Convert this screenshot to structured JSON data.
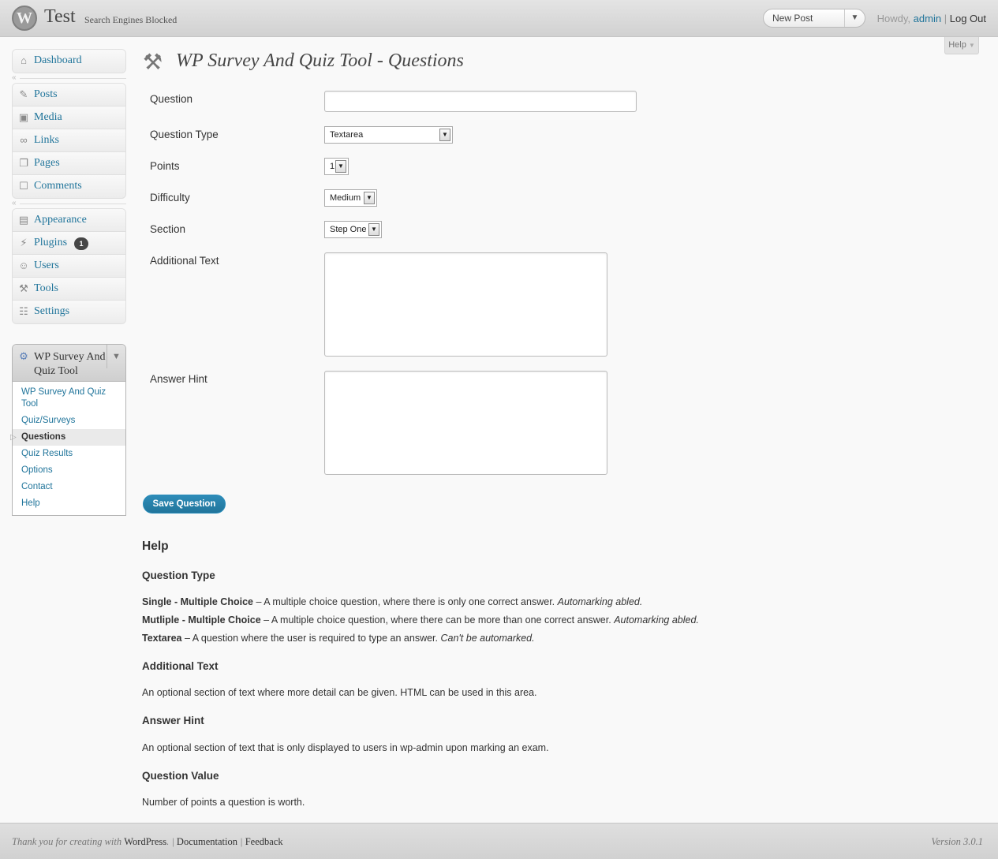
{
  "header": {
    "site_title": "Test",
    "site_status": "Search Engines Blocked",
    "favorite_action": "New Post",
    "howdy": "Howdy,",
    "user": "admin",
    "separator": "|",
    "logout": "Log Out"
  },
  "help_tab": "Help",
  "menu": {
    "group1": [
      {
        "label": "Dashboard",
        "icon": "dashboard-icon"
      }
    ],
    "group2": [
      {
        "label": "Posts",
        "icon": "pin-icon"
      },
      {
        "label": "Media",
        "icon": "media-icon"
      },
      {
        "label": "Links",
        "icon": "link-icon"
      },
      {
        "label": "Pages",
        "icon": "pages-icon"
      },
      {
        "label": "Comments",
        "icon": "comments-icon"
      }
    ],
    "group3": [
      {
        "label": "Appearance",
        "icon": "appearance-icon"
      },
      {
        "label": "Plugins",
        "icon": "plugin-icon",
        "badge": "1"
      },
      {
        "label": "Users",
        "icon": "users-icon"
      },
      {
        "label": "Tools",
        "icon": "tools-icon"
      },
      {
        "label": "Settings",
        "icon": "settings-icon"
      }
    ],
    "plugin": {
      "label": "WP Survey And Quiz Tool",
      "items": [
        "WP Survey And Quiz Tool",
        "Quiz/Surveys",
        "Questions",
        "Quiz Results",
        "Options",
        "Contact",
        "Help"
      ],
      "current": "Questions"
    }
  },
  "page": {
    "title": "WP Survey And Quiz Tool - Questions",
    "fields": {
      "question_label": "Question",
      "question_value": "",
      "type_label": "Question Type",
      "type_value": "Textarea",
      "points_label": "Points",
      "points_value": "1",
      "difficulty_label": "Difficulty",
      "difficulty_value": "Medium",
      "section_label": "Section",
      "section_value": "Step One",
      "additional_label": "Additional Text",
      "additional_value": "",
      "hint_label": "Answer Hint",
      "hint_value": ""
    },
    "save_label": "Save Question"
  },
  "help": {
    "title": "Help",
    "type_heading": "Question Type",
    "type_lines": [
      {
        "term": "Single - Multiple Choice",
        "desc": " – A multiple choice question, where there is only one correct answer. ",
        "note": "Automarking abled."
      },
      {
        "term": "Mutliple - Multiple Choice",
        "desc": " – A multiple choice question, where there can be more than one correct answer. ",
        "note": "Automarking abled."
      },
      {
        "term": "Textarea",
        "desc": " – A question where the user is required to type an answer. ",
        "note": "Can't be automarked."
      }
    ],
    "additional_heading": "Additional Text",
    "additional_text": "An optional section of text where more detail can be given. HTML can be used in this area.",
    "hint_heading": "Answer Hint",
    "hint_text": "An optional section of text that is only displayed to users in wp-admin upon marking an exam.",
    "value_heading": "Question Value",
    "value_text": "Number of points a question is worth."
  },
  "footer": {
    "thanks": "Thank you for creating with",
    "wordpress": "WordPress",
    "documentation": "Documentation",
    "feedback": "Feedback",
    "version": "Version 3.0.1"
  }
}
